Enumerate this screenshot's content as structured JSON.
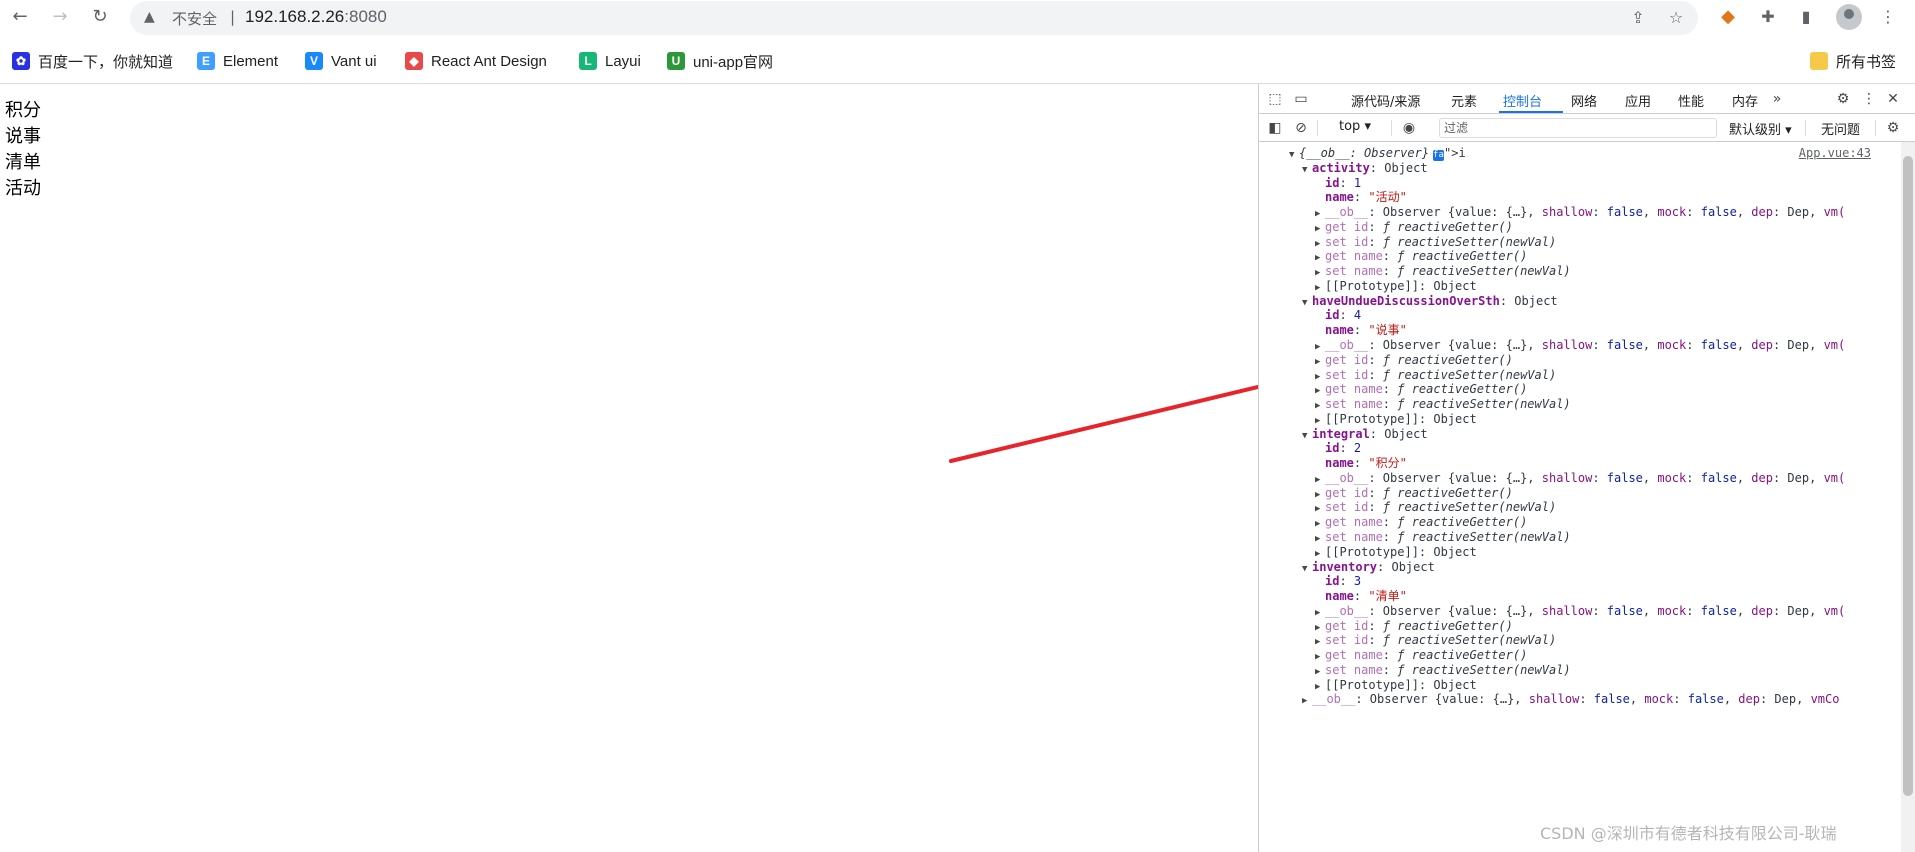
{
  "browser": {
    "insecure_label": "不安全",
    "separator": "|",
    "url_host": "192.168.2.26",
    "url_port": ":8080"
  },
  "bookmarks": [
    {
      "label": "百度一下，你就知道",
      "icon": "baidu-paw-icon",
      "color": "#2932e1"
    },
    {
      "label": "Element",
      "icon": "element-icon",
      "color": "#409eff"
    },
    {
      "label": "Vant ui",
      "icon": "vant-icon",
      "color": "#1989fa"
    },
    {
      "label": "React Ant Design",
      "icon": "ant-design-icon",
      "color": "#e84a4a"
    },
    {
      "label": "Layui",
      "icon": "layui-icon",
      "color": "#16b777"
    },
    {
      "label": "uni-app官网",
      "icon": "uniapp-icon",
      "color": "#2b9939"
    }
  ],
  "bookmarks_all": "所有书签",
  "page": {
    "items": [
      "积分",
      "说事",
      "清单",
      "活动"
    ]
  },
  "devtools": {
    "tabs": [
      "源代码/来源",
      "元素",
      "控制台",
      "网络",
      "应用",
      "性能",
      "内存"
    ],
    "active_tab": "控制台",
    "context": "top",
    "filter_placeholder": "过滤",
    "level": "默认级别",
    "issues": "无问题",
    "source_link": "App.vue:43"
  },
  "console": {
    "root_label": "{__ob__: Observer}",
    "objects": [
      {
        "key": "activity",
        "id": "1",
        "name": "\"活动\""
      },
      {
        "key": "haveUndueDiscussionOverSth",
        "id": "4",
        "name": "\"说事\""
      },
      {
        "key": "integral",
        "id": "2",
        "name": "\"积分\""
      },
      {
        "key": "inventory",
        "id": "3",
        "name": "\"清单\""
      }
    ],
    "type_object": "Object",
    "ob_line": "Observer {value: {…}, shallow: false, mock: false, dep: Dep, vm(",
    "ob_last_line": "Observer {value: {…}, shallow: false, mock: false, dep: Dep, vmCo",
    "getter": "reactiveGetter()",
    "setter": "reactiveSetter(newVal)",
    "prototype": "[[Prototype]]",
    "f": "ƒ"
  },
  "watermark": "CSDN @深圳市有德者科技有限公司-耿瑞",
  "colors": {
    "accent": "#1a73e8",
    "arrow": "#e8232a"
  }
}
